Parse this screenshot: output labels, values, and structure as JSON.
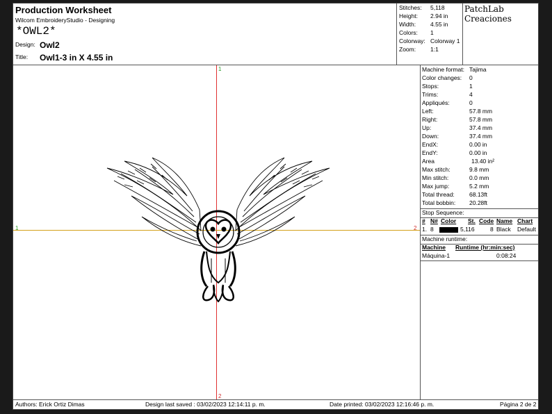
{
  "header": {
    "title": "Production Worksheet",
    "software": "Wilcom EmbroideryStudio - Designing",
    "design_code": "*OWL2*",
    "design_label": "Design:",
    "design_value": "Owl2",
    "title_label": "Title:",
    "title_value": "Owl1-3 in X 4.55 in"
  },
  "summary": [
    {
      "label": "Stitches:",
      "value": "5,118"
    },
    {
      "label": "Height:",
      "value": "2.94 in"
    },
    {
      "label": "Width:",
      "value": "4.55 in"
    },
    {
      "label": "Colors:",
      "value": "1"
    },
    {
      "label": "Colorway:",
      "value": "Colorway 1"
    },
    {
      "label": "Zoom:",
      "value": "1:1"
    }
  ],
  "logo": {
    "line1": "PatchLab",
    "line2": "Creaciones"
  },
  "machine": [
    {
      "label": "Machine format:",
      "value": "Tajima"
    },
    {
      "label": "Color changes:",
      "value": "0"
    },
    {
      "label": "Stops:",
      "value": "1"
    },
    {
      "label": "Trims:",
      "value": "4"
    },
    {
      "label": "Appliqués:",
      "value": "0"
    },
    {
      "label": "Left:",
      "value": "57.8 mm"
    },
    {
      "label": "Right:",
      "value": "57.8 mm"
    },
    {
      "label": "Up:",
      "value": "37.4 mm"
    },
    {
      "label": "Down:",
      "value": "37.4 mm"
    },
    {
      "label": "EndX:",
      "value": "0.00 in"
    },
    {
      "label": "EndY:",
      "value": "0.00 in"
    },
    {
      "label": "Area",
      "value": "13.40 in²"
    },
    {
      "label": "Max stitch:",
      "value": "9.8 mm"
    },
    {
      "label": "Min stitch:",
      "value": "0.0 mm"
    },
    {
      "label": "Max jump:",
      "value": "5.2 mm"
    },
    {
      "label": "Total thread:",
      "value": "68.13ft"
    },
    {
      "label": "Total bobbin:",
      "value": "20.28ft"
    }
  ],
  "stop_sequence": {
    "title": "Stop Sequence:",
    "headers": [
      "#",
      "N#",
      "Color",
      "St.",
      "Code",
      "Name",
      "Chart"
    ],
    "rows": [
      {
        "num": "1.",
        "n": "8",
        "swatch": "#000000",
        "st": "5,116",
        "code": "8",
        "name": "Black",
        "chart": "Default"
      }
    ]
  },
  "runtime": {
    "title": "Machine runtime:",
    "headers": [
      "Machine",
      "Runtime (hr:min:sec)"
    ],
    "rows": [
      {
        "machine": "Máquina-1",
        "time": "0:08:24"
      }
    ]
  },
  "canvas": {
    "marker_top": "1",
    "marker_left": "1",
    "marker_right": "2",
    "marker_bottom": "2",
    "h_axis_color": "#d4a017",
    "v_axis_color": "#e03030"
  },
  "footer": {
    "authors": "Authors: Erick Ortiz Dimas",
    "saved": "Design last saved : 03/02/2023 12:14:11 p. m.",
    "printed": "Date printed: 03/02/2023 12:16:46 p. m.",
    "page": "Página 2 de 2"
  }
}
